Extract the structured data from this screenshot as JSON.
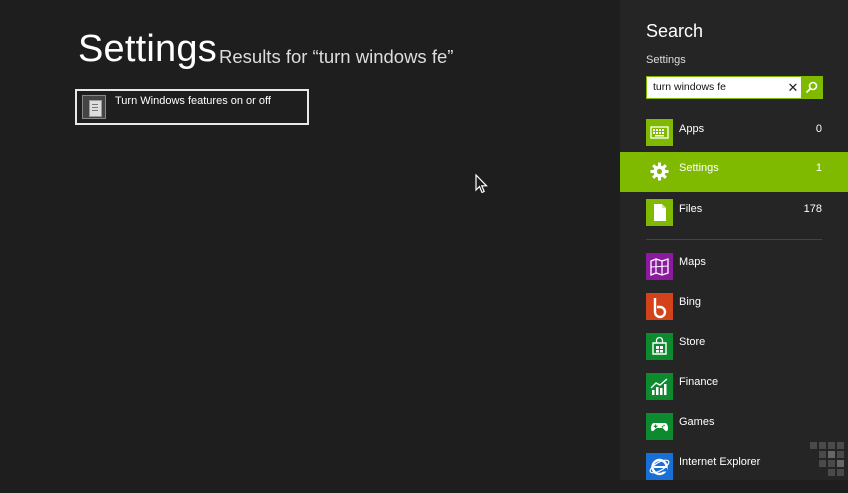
{
  "main": {
    "title": "Settings",
    "results_for": "Results for “turn windows fe”",
    "results": [
      {
        "label": "Turn Windows features on or off",
        "icon": "windows-features-icon"
      }
    ]
  },
  "pane": {
    "title": "Search",
    "scope": "Settings",
    "query": "turn windows fe",
    "clear_icon": "close-icon",
    "search_icon": "search-icon",
    "accent": "#7fba00",
    "categories": [
      {
        "label": "Apps",
        "count": "0",
        "icon": "apps-icon",
        "color": "#7fba00"
      },
      {
        "label": "Settings",
        "count": "1",
        "icon": "gear-icon",
        "color": "#7fba00",
        "selected": true
      },
      {
        "label": "Files",
        "count": "178",
        "icon": "file-icon",
        "color": "#7fba00"
      }
    ],
    "apps": [
      {
        "label": "Maps",
        "icon": "maps-icon",
        "color": "#8b1a9e"
      },
      {
        "label": "Bing",
        "icon": "bing-icon",
        "color": "#d2431b"
      },
      {
        "label": "Store",
        "icon": "store-icon",
        "color": "#0c8a2d"
      },
      {
        "label": "Finance",
        "icon": "finance-icon",
        "color": "#0c8a2d"
      },
      {
        "label": "Games",
        "icon": "games-icon",
        "color": "#0c8a2d"
      },
      {
        "label": "Internet Explorer",
        "icon": "ie-icon",
        "color": "#1a6fd6"
      }
    ]
  }
}
